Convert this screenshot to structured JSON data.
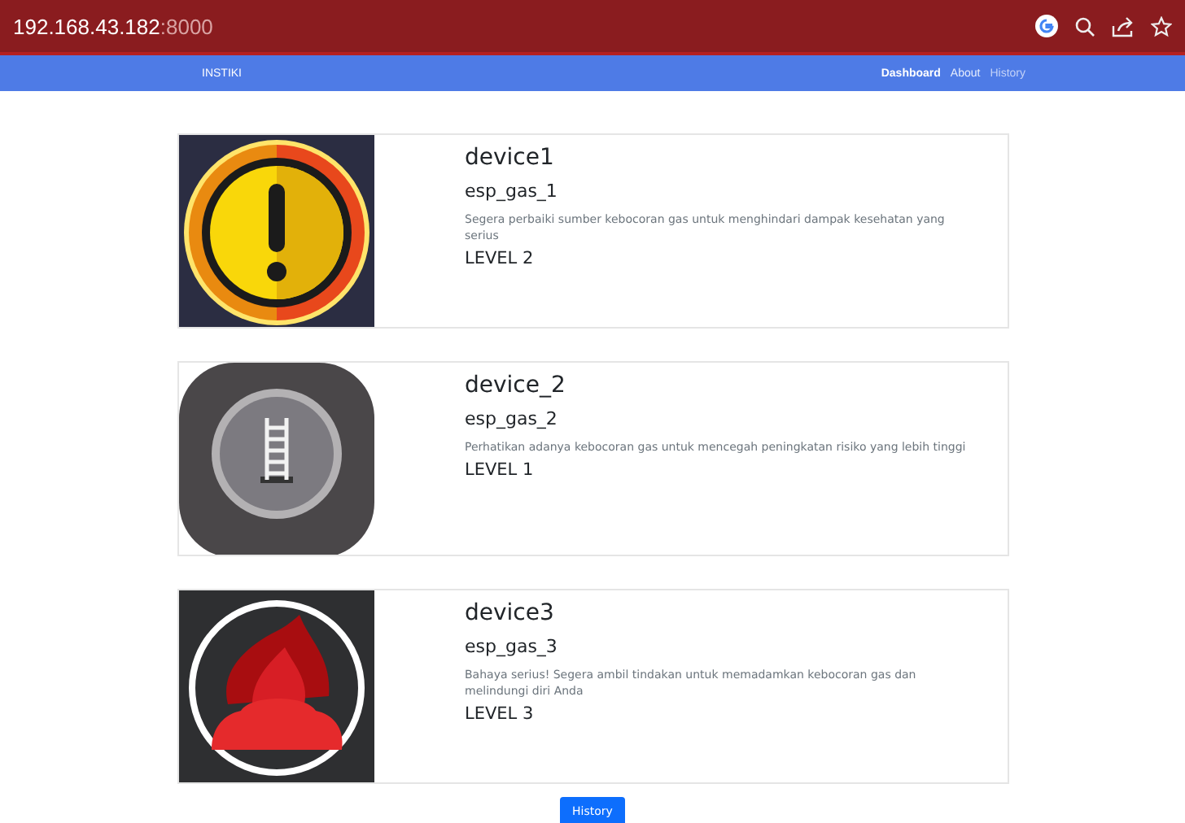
{
  "browser": {
    "url_host": "192.168.43.182",
    "url_port": ":8000"
  },
  "navbar": {
    "brand": "INSTIKI",
    "links": [
      {
        "label": "Dashboard",
        "selected": true,
        "disabled": false
      },
      {
        "label": "About",
        "selected": false,
        "disabled": false
      },
      {
        "label": "History",
        "selected": false,
        "disabled": true
      }
    ]
  },
  "devices": [
    {
      "kind": "warning",
      "name": "device1",
      "sensor": "esp_gas_1",
      "message": "Segera perbaiki sumber kebocoran gas untuk menghindari dampak kesehatan yang serius",
      "level": "LEVEL 2"
    },
    {
      "kind": "ladder",
      "name": "device_2",
      "sensor": "esp_gas_2",
      "message": "Perhatikan adanya kebocoran gas untuk mencegah peningkatan risiko yang lebih tinggi",
      "level": "LEVEL 1"
    },
    {
      "kind": "fire",
      "name": "device3",
      "sensor": "esp_gas_3",
      "message": "Bahaya serius! Segera ambil tindakan untuk memadamkan kebocoran gas dan melindungi diri Anda",
      "level": "LEVEL 3"
    }
  ],
  "history_button": "History"
}
